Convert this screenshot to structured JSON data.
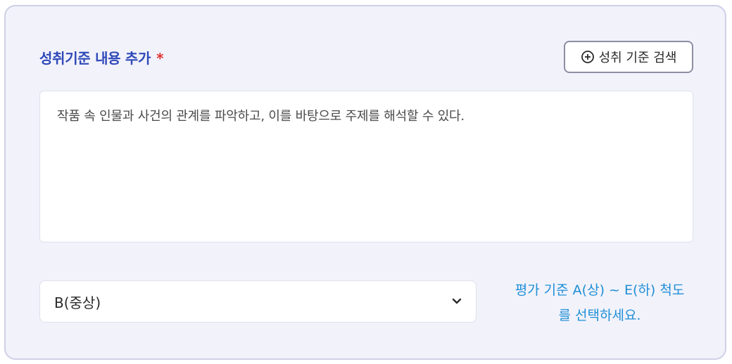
{
  "section": {
    "title": "성취기준 내용 추가",
    "required_mark": "*",
    "search_button_label": "성취 기준 검색"
  },
  "textarea": {
    "value": "작품 속 인물과 사건의 관계를 파악하고, 이를 바탕으로 주제를 해석할 수 있다."
  },
  "select": {
    "selected": "B(중상)"
  },
  "hint": {
    "line1": "평가 기준 A(상) ~ E(하) 척도",
    "line2": "를 선택하세요."
  },
  "colors": {
    "title": "#2f49b8",
    "required": "#e0312e",
    "hint": "#1e8fd6",
    "card_bg": "#f2f2fb"
  },
  "icons": {
    "search_button": "plus-circle-icon",
    "select": "chevron-down-icon"
  }
}
